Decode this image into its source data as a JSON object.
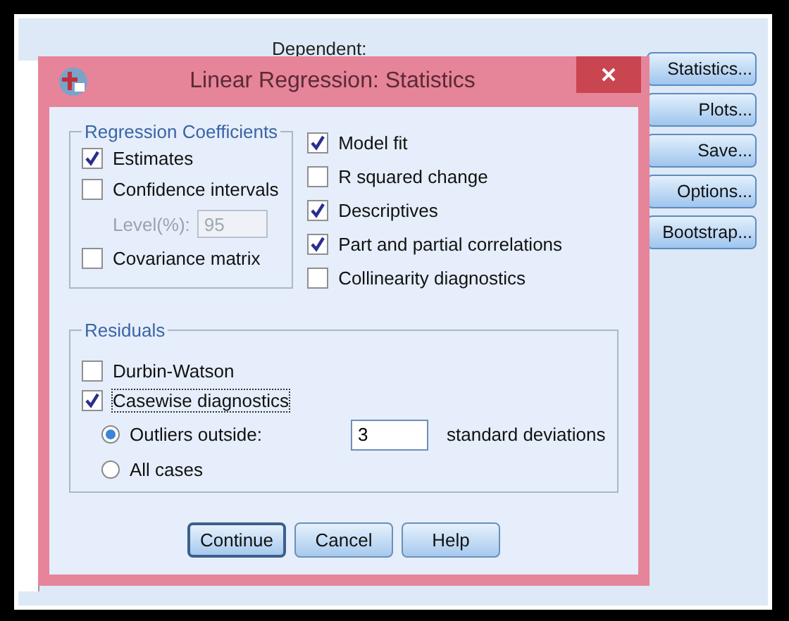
{
  "parent": {
    "dependent_label": "Dependent:",
    "buttons": [
      "Statistics...",
      "Plots...",
      "Save...",
      "Options...",
      "Bootstrap..."
    ]
  },
  "dialog": {
    "title": "Linear Regression: Statistics",
    "coefficients": {
      "title": "Regression Coefficients",
      "items": [
        {
          "kind": "checkbox",
          "label": "Estimates",
          "checked": true
        },
        {
          "kind": "checkbox",
          "label": "Confidence intervals",
          "checked": false
        },
        {
          "kind": "level-field",
          "label": "Level(%):",
          "value": "95",
          "disabled": true
        },
        {
          "kind": "checkbox",
          "label": "Covariance matrix",
          "checked": false
        }
      ]
    },
    "options": [
      {
        "label": "Model fit",
        "checked": true
      },
      {
        "label": "R squared change",
        "checked": false
      },
      {
        "label": "Descriptives",
        "checked": true
      },
      {
        "label": "Part and partial correlations",
        "checked": true
      },
      {
        "label": "Collinearity diagnostics",
        "checked": false
      }
    ],
    "residuals": {
      "title": "Residuals",
      "checks": [
        {
          "label": "Durbin-Watson",
          "checked": false,
          "focused": false
        },
        {
          "label": "Casewise diagnostics",
          "checked": true,
          "focused": true
        }
      ],
      "radios": [
        {
          "label": "Outliers outside:",
          "selected": true,
          "value": "3",
          "suffix": "standard deviations"
        },
        {
          "label": "All cases",
          "selected": false
        }
      ]
    },
    "buttons": [
      {
        "label": "Continue",
        "default": true
      },
      {
        "label": "Cancel",
        "default": false
      },
      {
        "label": "Help",
        "default": false
      }
    ]
  }
}
